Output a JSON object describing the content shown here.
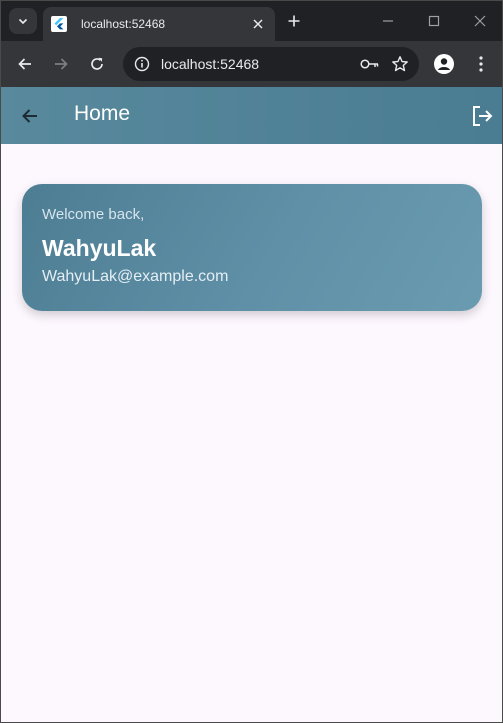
{
  "browser": {
    "tab_title": "localhost:52468",
    "url": "localhost:52468"
  },
  "app": {
    "title": "Home",
    "accent_color": "#4f8197"
  },
  "profile_card": {
    "greeting": "Welcome back,",
    "name": "WahyuLak",
    "email": "WahyuLak@example.com"
  },
  "icons": {
    "tab_search": "chevron-down-icon",
    "favicon": "flutter-logo-icon",
    "tab_close": "close-icon",
    "new_tab": "plus-icon",
    "minimize": "minimize-icon",
    "maximize": "maximize-icon",
    "close_window": "close-icon",
    "back": "arrow-left-icon",
    "forward": "arrow-right-icon",
    "reload": "reload-icon",
    "site_info": "info-icon",
    "passwords": "key-icon",
    "bookmark": "star-icon",
    "profile": "person-icon",
    "menu": "kebab-menu-icon",
    "app_back": "arrow-left-icon",
    "logout": "logout-icon"
  }
}
